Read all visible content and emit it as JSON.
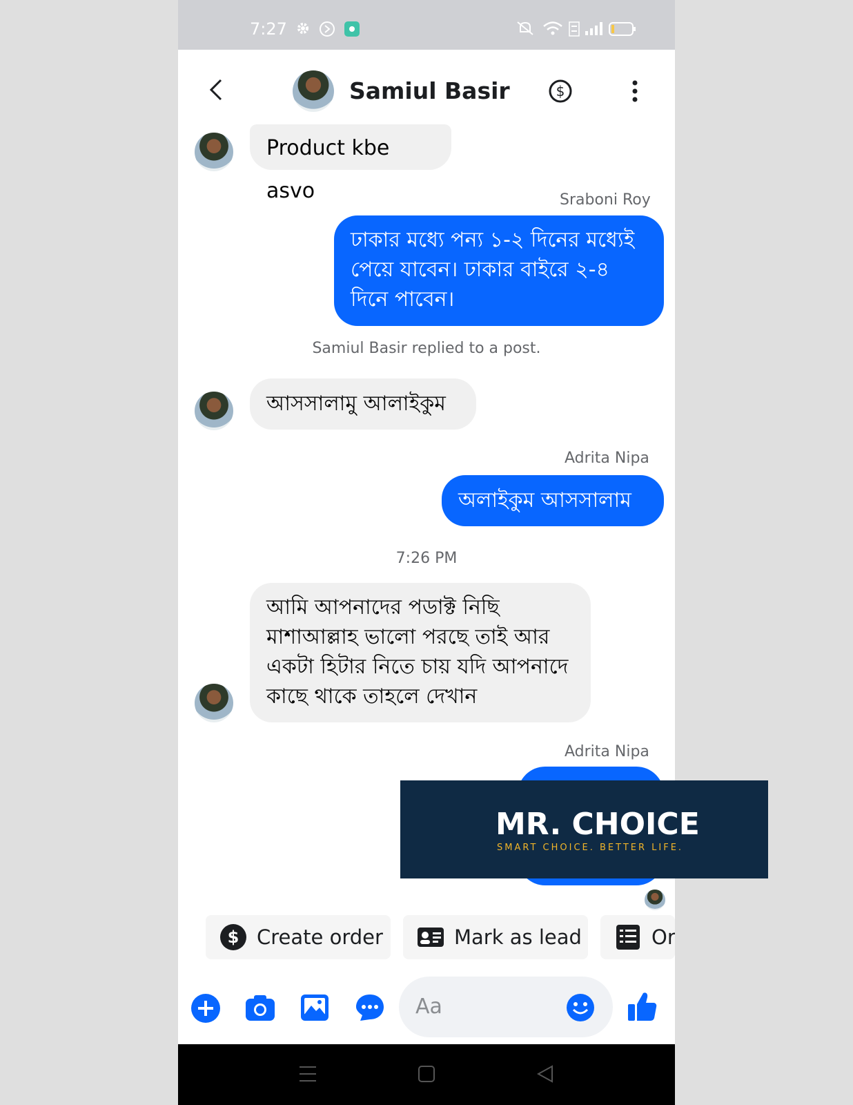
{
  "status_bar": {
    "time": "7:27"
  },
  "header": {
    "contact_name": "Samiul Basir"
  },
  "messages": [
    {
      "text": "Product kbe asvo"
    },
    {
      "sender": "Sraboni Roy",
      "text": "ঢাকার মধ্যে পন্য ১-২ দিনের মধ্যেই পেয়ে যাবেন। ঢাকার বাইরে ২-৪ দিনে পাবেন।"
    },
    {
      "note": "Samiul Basir replied to a post."
    },
    {
      "text": "আসসালামু আলাইকুম"
    },
    {
      "sender": "Adrita Nipa",
      "text": "অলাইকুম আসসালাম"
    },
    {
      "timestamp": "7:26 PM"
    },
    {
      "text": "আমি আপনাদের পডাক্ট নিছি মাশাআল্লাহ  ভালো পরছে তাই আর একটা হিটার নিতে চায় যদি আপনাদে কাছে থাকে তাহলে দেখান"
    },
    {
      "sender": "Adrita Nipa"
    }
  ],
  "actions": {
    "create_order": "Create order",
    "mark_as_lead": "Mark as lead",
    "orders": "Or"
  },
  "composer": {
    "placeholder": "Aa"
  },
  "watermark": {
    "title": "MR. CHOICE",
    "tagline": "SMART CHOICE. BETTER LIFE."
  },
  "colors": {
    "brand_blue": "#0866ff",
    "watermark_bg": "#0f2a44",
    "watermark_accent": "#f0b429"
  }
}
